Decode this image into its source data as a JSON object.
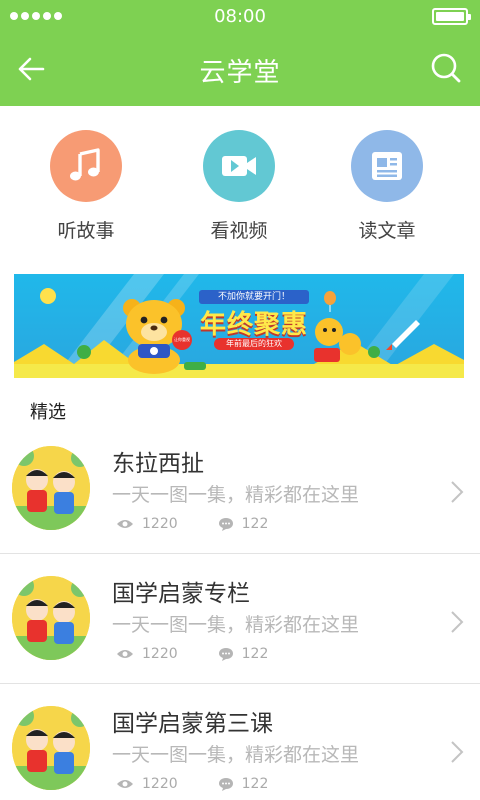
{
  "status_bar": {
    "time": "08:00"
  },
  "header": {
    "title": "云学堂",
    "back_icon": "back-arrow-icon",
    "search_icon": "search-icon"
  },
  "shortcuts": [
    {
      "label": "听故事",
      "icon": "music-note-icon",
      "color": "#f79b74"
    },
    {
      "label": "看视频",
      "icon": "video-camera-icon",
      "color": "#62c8d3"
    },
    {
      "label": "读文章",
      "icon": "article-icon",
      "color": "#8fb8e8"
    }
  ],
  "banner": {
    "headline": "年终聚惠",
    "tagline": "不加你就要开门！",
    "subline": "年前最后的狂欢",
    "badge": "让你重视"
  },
  "section": {
    "title": "精选"
  },
  "list": [
    {
      "title": "东拉西扯",
      "subtitle": "一天一图一集，精彩都在这里",
      "views": "1220",
      "comments": "122"
    },
    {
      "title": "国学启蒙专栏",
      "subtitle": "一天一图一集，精彩都在这里",
      "views": "1220",
      "comments": "122"
    },
    {
      "title": "国学启蒙第三课",
      "subtitle": "一天一图一集，精彩都在这里",
      "views": "1220",
      "comments": "122"
    }
  ],
  "colors": {
    "header": "#7ed152",
    "subtitle_text": "#b8b8b8"
  }
}
